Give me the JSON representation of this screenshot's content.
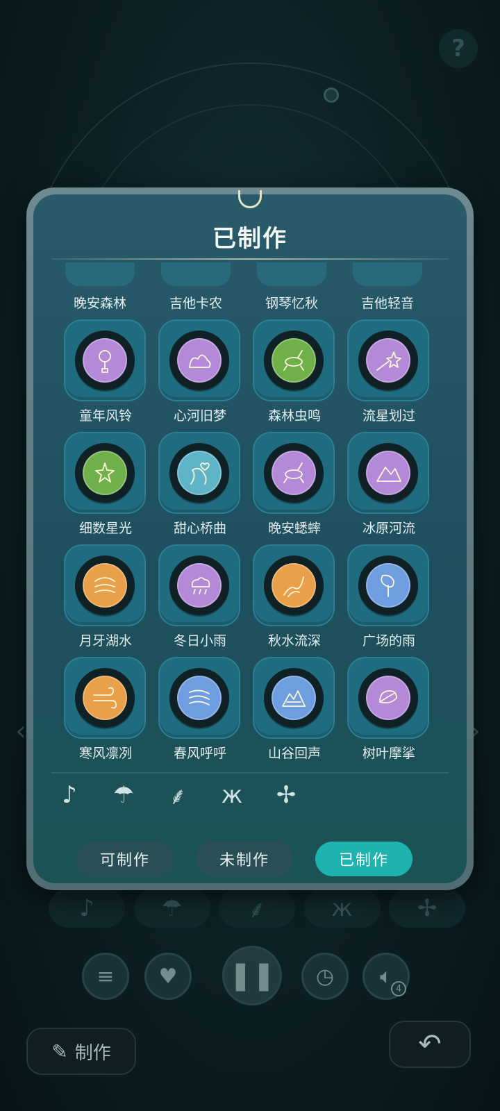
{
  "modal": {
    "title": "已制作",
    "partial_row": [
      "晚安森林",
      "吉他卡农",
      "钢琴忆秋",
      "吉他轻音"
    ],
    "items": [
      {
        "label": "童年风铃",
        "color": "#b48ad8",
        "icon": "wind-chime-icon"
      },
      {
        "label": "心河旧梦",
        "color": "#b48ad8",
        "icon": "bush-icon"
      },
      {
        "label": "森林虫鸣",
        "color": "#6fb04b",
        "icon": "cricket-icon"
      },
      {
        "label": "流星划过",
        "color": "#b48ad8",
        "icon": "shooting-star-icon"
      },
      {
        "label": "细数星光",
        "color": "#6fb04b",
        "icon": "starlight-icon"
      },
      {
        "label": "甜心桥曲",
        "color": "#5fb4c8",
        "icon": "heart-river-icon"
      },
      {
        "label": "晚安蟋蟀",
        "color": "#b48ad8",
        "icon": "cricket-icon"
      },
      {
        "label": "冰原河流",
        "color": "#b48ad8",
        "icon": "mountain-river-icon"
      },
      {
        "label": "月牙湖水",
        "color": "#e8a04a",
        "icon": "lake-icon"
      },
      {
        "label": "冬日小雨",
        "color": "#b48ad8",
        "icon": "rain-cloud-icon"
      },
      {
        "label": "秋水流深",
        "color": "#e8a04a",
        "icon": "river-icon"
      },
      {
        "label": "广场的雨",
        "color": "#6f9ee0",
        "icon": "leaf-icon"
      },
      {
        "label": "寒风凛冽",
        "color": "#e8a04a",
        "icon": "wind-icon"
      },
      {
        "label": "春风呼呼",
        "color": "#6f9ee0",
        "icon": "breeze-icon"
      },
      {
        "label": "山谷回声",
        "color": "#6f9ee0",
        "icon": "valley-icon"
      },
      {
        "label": "树叶摩挲",
        "color": "#b48ad8",
        "icon": "leaves-icon"
      }
    ],
    "categories": [
      "music-note-icon",
      "rain-icon",
      "grass-icon",
      "butterfly-icon",
      "pinwheel-icon"
    ],
    "tabs": {
      "can_make": "可制作",
      "not_made": "未制作",
      "made": "已制作"
    }
  },
  "controls": {
    "make_label": "制作",
    "volume_badge": "4",
    "help": "?"
  }
}
